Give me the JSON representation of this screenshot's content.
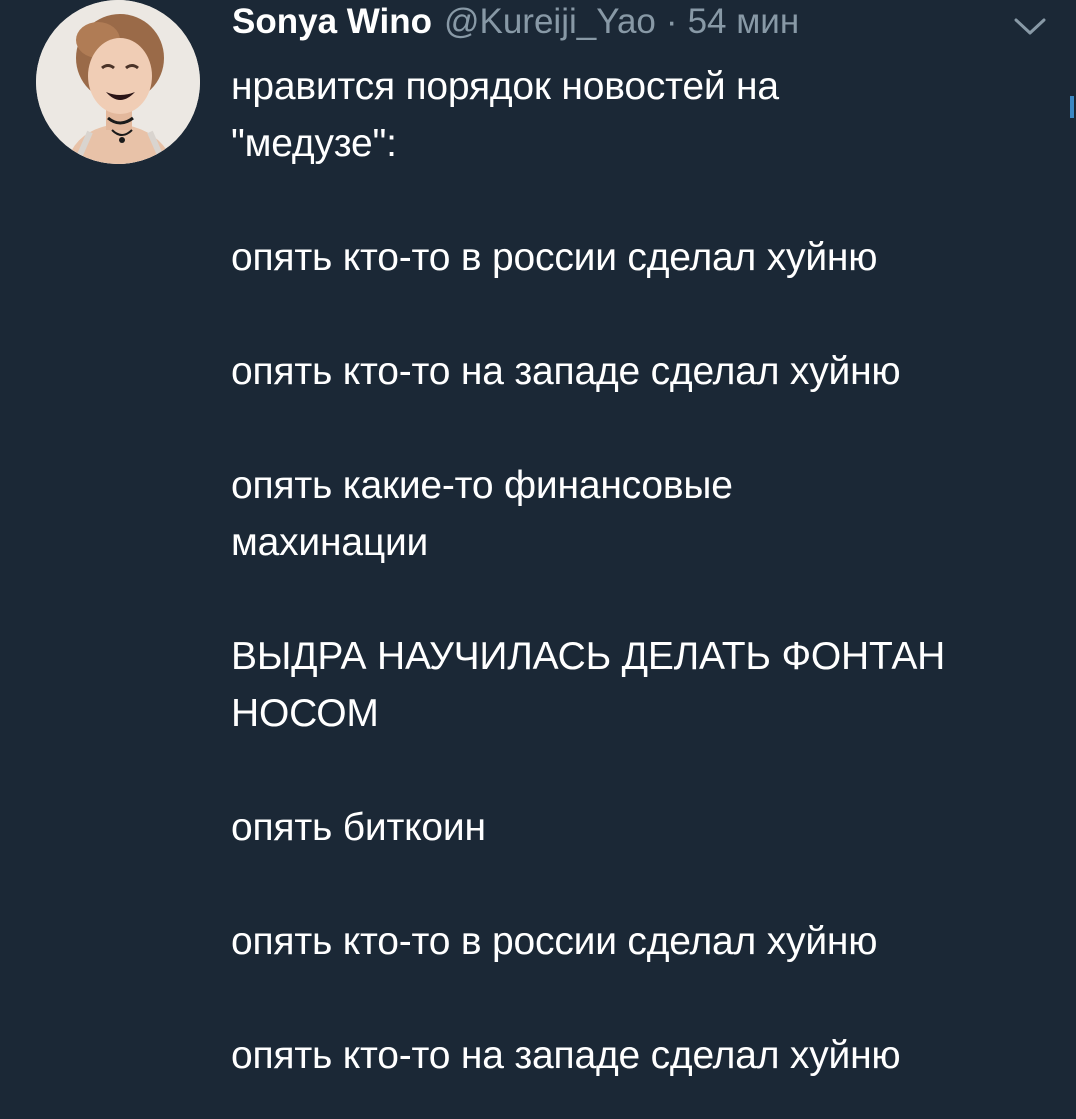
{
  "tweet": {
    "author": {
      "display_name": "Sonya Wino",
      "handle": "@Kureiji_Yao"
    },
    "separator": "·",
    "time": "54 мин",
    "caret_icon": "chevron-down-icon",
    "paragraphs": [
      "нравится порядок новостей на\n\"медузе\":",
      "опять кто-то в россии сделал хуйню",
      "опять кто-то на западе сделал хуйню",
      "опять какие-то финансовые\nмахинации",
      "ВЫДРА НАУЧИЛАСЬ ДЕЛАТЬ ФОНТАН\nНОСОМ",
      "опять биткоин",
      "опять кто-то в россии сделал хуйню",
      "опять кто-то на западе сделал хуйню"
    ]
  },
  "colors": {
    "background": "#1b2836",
    "primary_text": "#ffffff",
    "secondary_text": "#8899a6",
    "accent": "#3b88c3"
  }
}
